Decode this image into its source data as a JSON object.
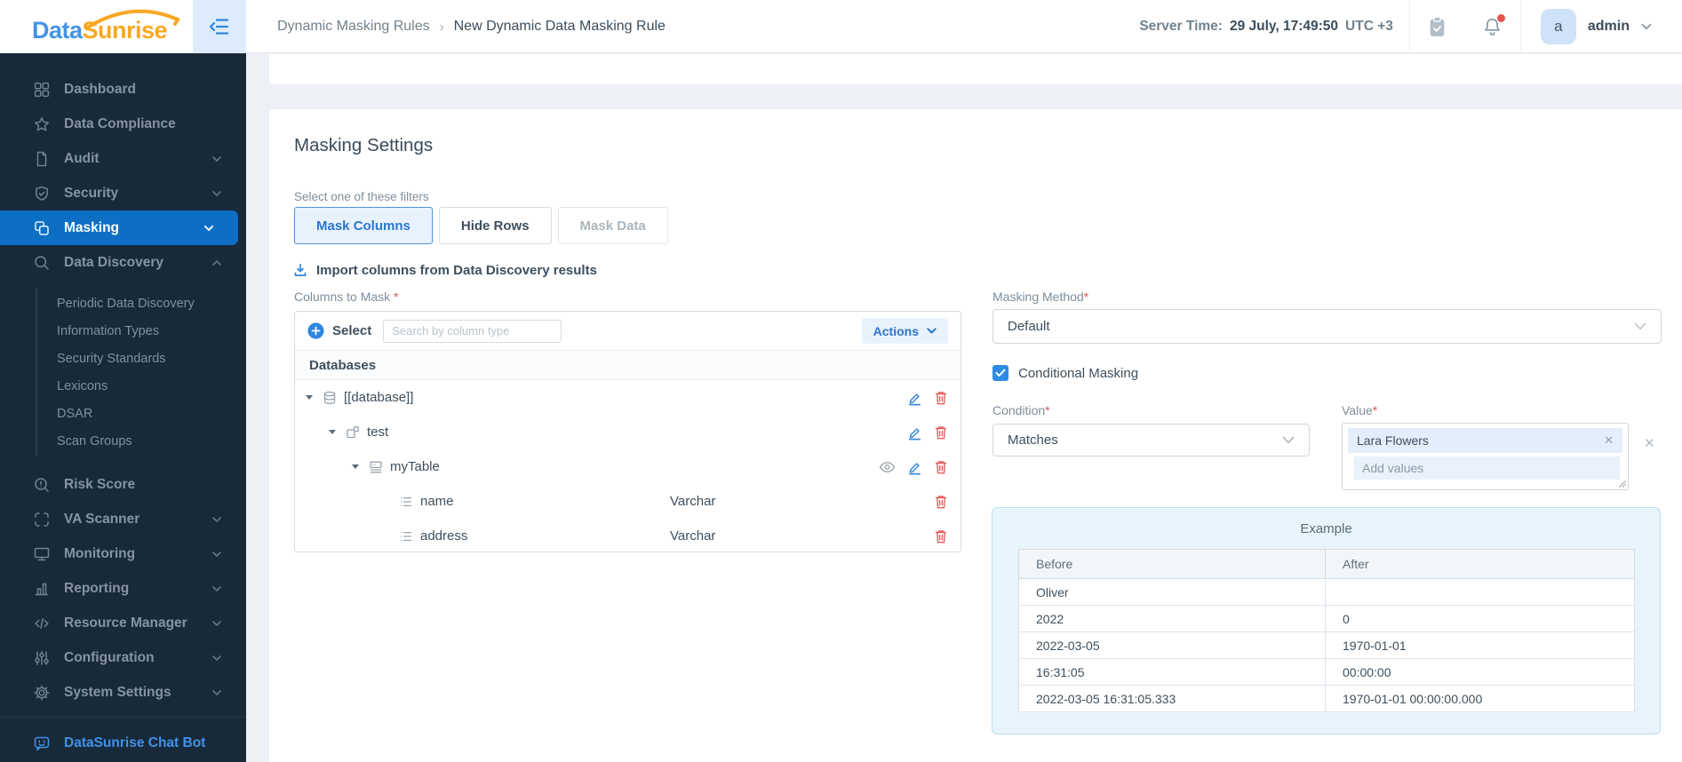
{
  "brand": {
    "part1": "Data",
    "part2": "Sunrise"
  },
  "topbar": {
    "breadcrumb_parent": "Dynamic Masking Rules",
    "breadcrumb_separator": "›",
    "breadcrumb_current": "New Dynamic Data Masking Rule",
    "server_time_label": "Server Time:",
    "server_time_value": "29 July, 17:49:50",
    "server_time_zone": "UTC +3",
    "user_initial": "a",
    "user_name": "admin"
  },
  "sidebar": {
    "items": [
      {
        "label": "Dashboard"
      },
      {
        "label": "Data Compliance"
      },
      {
        "label": "Audit"
      },
      {
        "label": "Security"
      },
      {
        "label": "Masking"
      },
      {
        "label": "Data Discovery"
      },
      {
        "label": "Risk Score"
      },
      {
        "label": "VA Scanner"
      },
      {
        "label": "Monitoring"
      },
      {
        "label": "Reporting"
      },
      {
        "label": "Resource Manager"
      },
      {
        "label": "Configuration"
      },
      {
        "label": "System Settings"
      }
    ],
    "submenu": [
      {
        "label": "Periodic Data Discovery"
      },
      {
        "label": "Information Types"
      },
      {
        "label": "Security Standards"
      },
      {
        "label": "Lexicons"
      },
      {
        "label": "DSAR"
      },
      {
        "label": "Scan Groups"
      }
    ],
    "chatbot_label": "DataSunrise Chat Bot"
  },
  "page": {
    "title": "Masking Settings",
    "filters_label": "Select one of these filters",
    "required_mark": "*",
    "filter_buttons": [
      {
        "label": "Mask Columns",
        "state": "selected"
      },
      {
        "label": "Hide Rows",
        "state": "normal"
      },
      {
        "label": "Mask Data",
        "state": "disabled"
      }
    ],
    "import_link": "Import columns from Data Discovery results",
    "columns_to_mask_label": "Columns to Mask",
    "columns_panel": {
      "select_label": "Select",
      "search_placeholder": "Search by column type",
      "actions_label": "Actions",
      "tree_header": "Databases",
      "tree": [
        {
          "label": "[[database]]",
          "type": ""
        },
        {
          "label": "test",
          "type": ""
        },
        {
          "label": "myTable",
          "type": ""
        },
        {
          "label": "name",
          "type": "Varchar"
        },
        {
          "label": "address",
          "type": "Varchar"
        }
      ]
    },
    "masking_method_label": "Masking Method",
    "masking_method_value": "Default",
    "conditional_masking_label": "Conditional Masking",
    "condition_label": "Condition",
    "condition_value": "Matches",
    "value_label": "Value",
    "value_tag": "Lara Flowers",
    "value_tag_remove": "✕",
    "value_clear": "✕",
    "value_placeholder": "Add values",
    "example": {
      "title": "Example",
      "columns": [
        "Before",
        "After"
      ],
      "rows": [
        [
          "Oliver",
          ""
        ],
        [
          "2022",
          "0"
        ],
        [
          "2022-03-05",
          "1970-01-01"
        ],
        [
          "16:31:05",
          "00:00:00"
        ],
        [
          "2022-03-05 16:31:05.333",
          "1970-01-01 00:00:00.000"
        ]
      ]
    }
  },
  "icons": {
    "collapse": "menu-fold-icon",
    "tasks": "clipboard-check-icon",
    "notifications": "bell-icon",
    "import": "download-icon",
    "select_add": "plus-circle-icon",
    "edit": "pencil-icon",
    "delete": "trash-icon",
    "preview": "eye-icon",
    "database": "database-icon",
    "schema": "schema-icon",
    "table": "table-icon",
    "column": "list-icon"
  },
  "colors": {
    "accent_blue": "#2e86de",
    "nav_active_blue": "#0d6fc4",
    "sidebar_bg": "#18293a",
    "logo_blue": "#4394e4",
    "logo_orange": "#f9a825",
    "danger_red": "#e2605e",
    "notification_red": "#e8504f",
    "selected_filter_bg": "#e8f2fd",
    "selected_filter_border": "#4d94dd",
    "tag_bg": "#e3eefa",
    "example_bg": "#e8f4fb",
    "example_border": "#bcdff2"
  }
}
